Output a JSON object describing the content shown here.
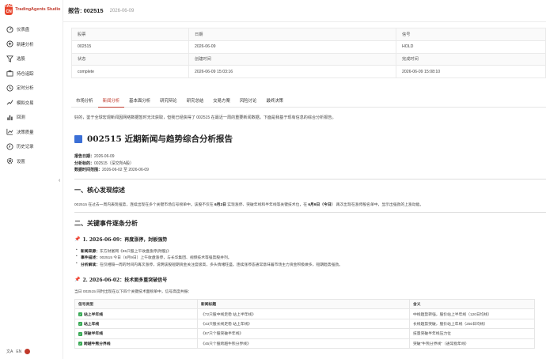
{
  "brand": {
    "logo_text": "TAG CN",
    "name": "TradingAgents Studio"
  },
  "sidebar": {
    "items": [
      {
        "label": "仪表盘",
        "icon": "dashboard-icon"
      },
      {
        "label": "新建分析",
        "icon": "plus-circle-icon"
      },
      {
        "label": "选股",
        "icon": "filter-icon"
      },
      {
        "label": "持仓追踪",
        "icon": "briefcase-icon"
      },
      {
        "label": "定时分析",
        "icon": "clock-icon"
      },
      {
        "label": "模拟交易",
        "icon": "trend-icon"
      },
      {
        "label": "回测",
        "icon": "bar-chart-icon"
      },
      {
        "label": "决策质量",
        "icon": "target-icon"
      },
      {
        "label": "历史记录",
        "icon": "history-icon"
      },
      {
        "label": "设置",
        "icon": "gear-icon"
      }
    ],
    "lang": "EN"
  },
  "header": {
    "title": "报告: 002515",
    "date": "2026-06-09"
  },
  "info_table": {
    "row1_headers": [
      "股票",
      "日期",
      "信号"
    ],
    "row1_values": [
      "002515",
      "2026-06-09",
      "HOLD"
    ],
    "row2_headers": [
      "状态",
      "创建时间",
      "完成时间"
    ],
    "row2_values": [
      "complete",
      "2026-06-09 15:03:16",
      "2026-06-09 15:08:10"
    ]
  },
  "tabs": [
    "市场分析",
    "新闻分析",
    "基本面分析",
    "研究辩论",
    "研究总结",
    "交易方案",
    "风险讨论",
    "最终决策"
  ],
  "lead": "好的，鉴于全球宏观新闻因网络数据暂时无法获取，但我已经获得了 002515 在最近一周的重要新闻数据。下面是我基于现有信息的综合分析报告。",
  "report": {
    "title": "002515 近期新闻与趋势综合分析报告",
    "meta": [
      {
        "k": "报告日期：",
        "v": "2026-06-09"
      },
      {
        "k": "分析标的：",
        "v": "002515（深交所A股）"
      },
      {
        "k": "数据时间范围：",
        "v": "2026-06-02 至 2026-06-09"
      }
    ],
    "s1_title": "一、核心发现综述",
    "s1_text_a": "002515 在过去一周内表现强势，连续出现在多个关键市场信号榜单中。该股不仅在 ",
    "s1_bold_a": "6月2日",
    "s1_text_b": " 实现涨停、突破年线和半年线等关键技术位，在 ",
    "s1_bold_b": "6月9日（今日）",
    "s1_text_c": " 再次出现在涨停股名单中，显示出强劲的上涨动能。",
    "s2_title": "二、关键事件逐条分析",
    "e1_title": "1. 2026-06-09：再度涨停，封板强势",
    "e1_bullets": [
      {
        "k": "新闻来源：",
        "v": "东方财富网《85只股上午收盘涨停(附股)》"
      },
      {
        "k": "事件描述：",
        "v": "002515 今日（6月9日）上午收盘涨停，与长华集团、视频技术等强势股并列。"
      },
      {
        "k": "分析解读：",
        "v": "在仅相隔一周的时间内再次涨停，说明该股短期资金关注度极高，多头情绪旺盛。连续涨停态通常意味着市场主力资金积极做多，短期趋势强劲。"
      }
    ],
    "e2_title": "2. 2026-06-02：技术面多重突破信号",
    "e2_intro": "当日 002515 同时出现在以下四个关键技术面榜单中，信号高度共振：",
    "sig_headers": [
      "信号类型",
      "新闻标题",
      "含义"
    ],
    "signals": [
      {
        "type": "站上半年线",
        "news": "《72只股中线走稳 站上半年线》",
        "mean": "中线趋势转强，股价站上半年线（120日均线）"
      },
      {
        "type": "站上年线",
        "news": "《43只股长线走稳 站上年线》",
        "mean": "长线趋势突破，股价站上年线（250日均线）"
      },
      {
        "type": "突破半年线",
        "news": "《67只个股突破半年线》",
        "mean": "技量突破半年线压力位"
      },
      {
        "type": "跨越牛熊分界线",
        "news": "《45只个股跨越牛熊分界线》",
        "mean": "突破\"牛熊分界线\"（通常指年线）"
      }
    ]
  }
}
